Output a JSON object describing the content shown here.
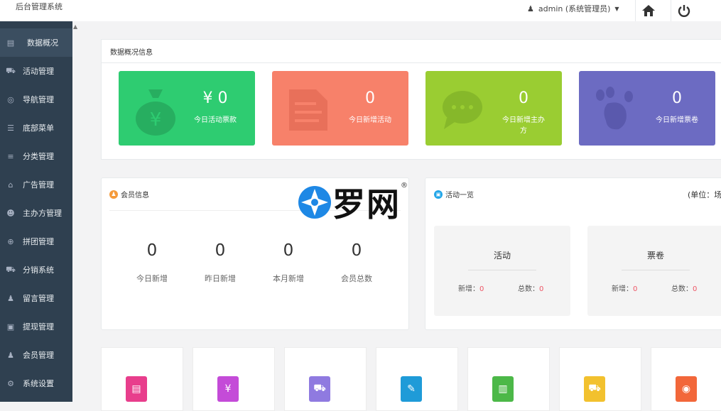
{
  "app": {
    "title": "后台管理系统"
  },
  "topbar": {
    "user_label": "admin (系统管理员)",
    "user_icon": "user-icon",
    "home_icon": "home-icon",
    "power_icon": "power-icon"
  },
  "sidebar": {
    "items": [
      {
        "label": "数据概况",
        "icon": "dashboard-icon",
        "glyph": "▤",
        "active": true
      },
      {
        "label": "活动管理",
        "icon": "cart-icon",
        "glyph": "⛟"
      },
      {
        "label": "导航管理",
        "icon": "compass-icon",
        "glyph": "◎"
      },
      {
        "label": "底部菜单",
        "icon": "menu-icon",
        "glyph": "☰"
      },
      {
        "label": "分类管理",
        "icon": "list-icon",
        "glyph": "≡"
      },
      {
        "label": "广告管理",
        "icon": "gift-icon",
        "glyph": "⌂"
      },
      {
        "label": "主办方管理",
        "icon": "users-icon",
        "glyph": "☻"
      },
      {
        "label": "拼团管理",
        "icon": "group-icon",
        "glyph": "⊕"
      },
      {
        "label": "分销系统",
        "icon": "cart-icon",
        "glyph": "⛟"
      },
      {
        "label": "留言管理",
        "icon": "user-icon",
        "glyph": "♟"
      },
      {
        "label": "提现管理",
        "icon": "money-icon",
        "glyph": "▣"
      },
      {
        "label": "会员管理",
        "icon": "user-icon",
        "glyph": "♟"
      },
      {
        "label": "系统设置",
        "icon": "gear-icon",
        "glyph": "⚙"
      }
    ]
  },
  "overview": {
    "title": "数据概况信息",
    "cards": [
      {
        "value": "¥ 0",
        "label": "今日活动票款",
        "color": "#2ecc71",
        "icon": "money-bag-icon"
      },
      {
        "value": "0",
        "label": "今日新增活动",
        "color": "#f7816a",
        "icon": "document-icon"
      },
      {
        "value": "0",
        "label": "今日新增主办方",
        "color": "#9acd32",
        "icon": "chat-icon"
      },
      {
        "value": "0",
        "label": "今日新增票卷",
        "color": "#6c6bc2",
        "icon": "paw-icon"
      }
    ]
  },
  "members": {
    "title": "会员信息",
    "stats": [
      {
        "value": "0",
        "label": "今日新增"
      },
      {
        "value": "0",
        "label": "昨日新增"
      },
      {
        "value": "0",
        "label": "本月新增"
      },
      {
        "value": "0",
        "label": "会员总数"
      }
    ]
  },
  "activities": {
    "title": "活动一览",
    "unit": "(单位：场",
    "boxes": [
      {
        "title": "活动",
        "new_label": "新增：",
        "new_value": "0",
        "total_label": "总数：",
        "total_value": "0"
      },
      {
        "title": "票卷",
        "new_label": "新增：",
        "new_value": "0",
        "total_label": "总数：",
        "total_value": "0"
      }
    ]
  },
  "watermark": {
    "text": "罗网",
    "mark": "®"
  },
  "shortcuts": [
    {
      "icon": "document-icon",
      "color": "#e83e8c"
    },
    {
      "icon": "money-bag-icon",
      "color": "#c44bd8"
    },
    {
      "icon": "truck-icon",
      "color": "#8f7ae0"
    },
    {
      "icon": "clipboard-icon",
      "color": "#1f9bd8"
    },
    {
      "icon": "notebook-icon",
      "color": "#4cb848"
    },
    {
      "icon": "cart-icon",
      "color": "#f2c12e"
    },
    {
      "icon": "coin-icon",
      "color": "#f2673a"
    }
  ]
}
